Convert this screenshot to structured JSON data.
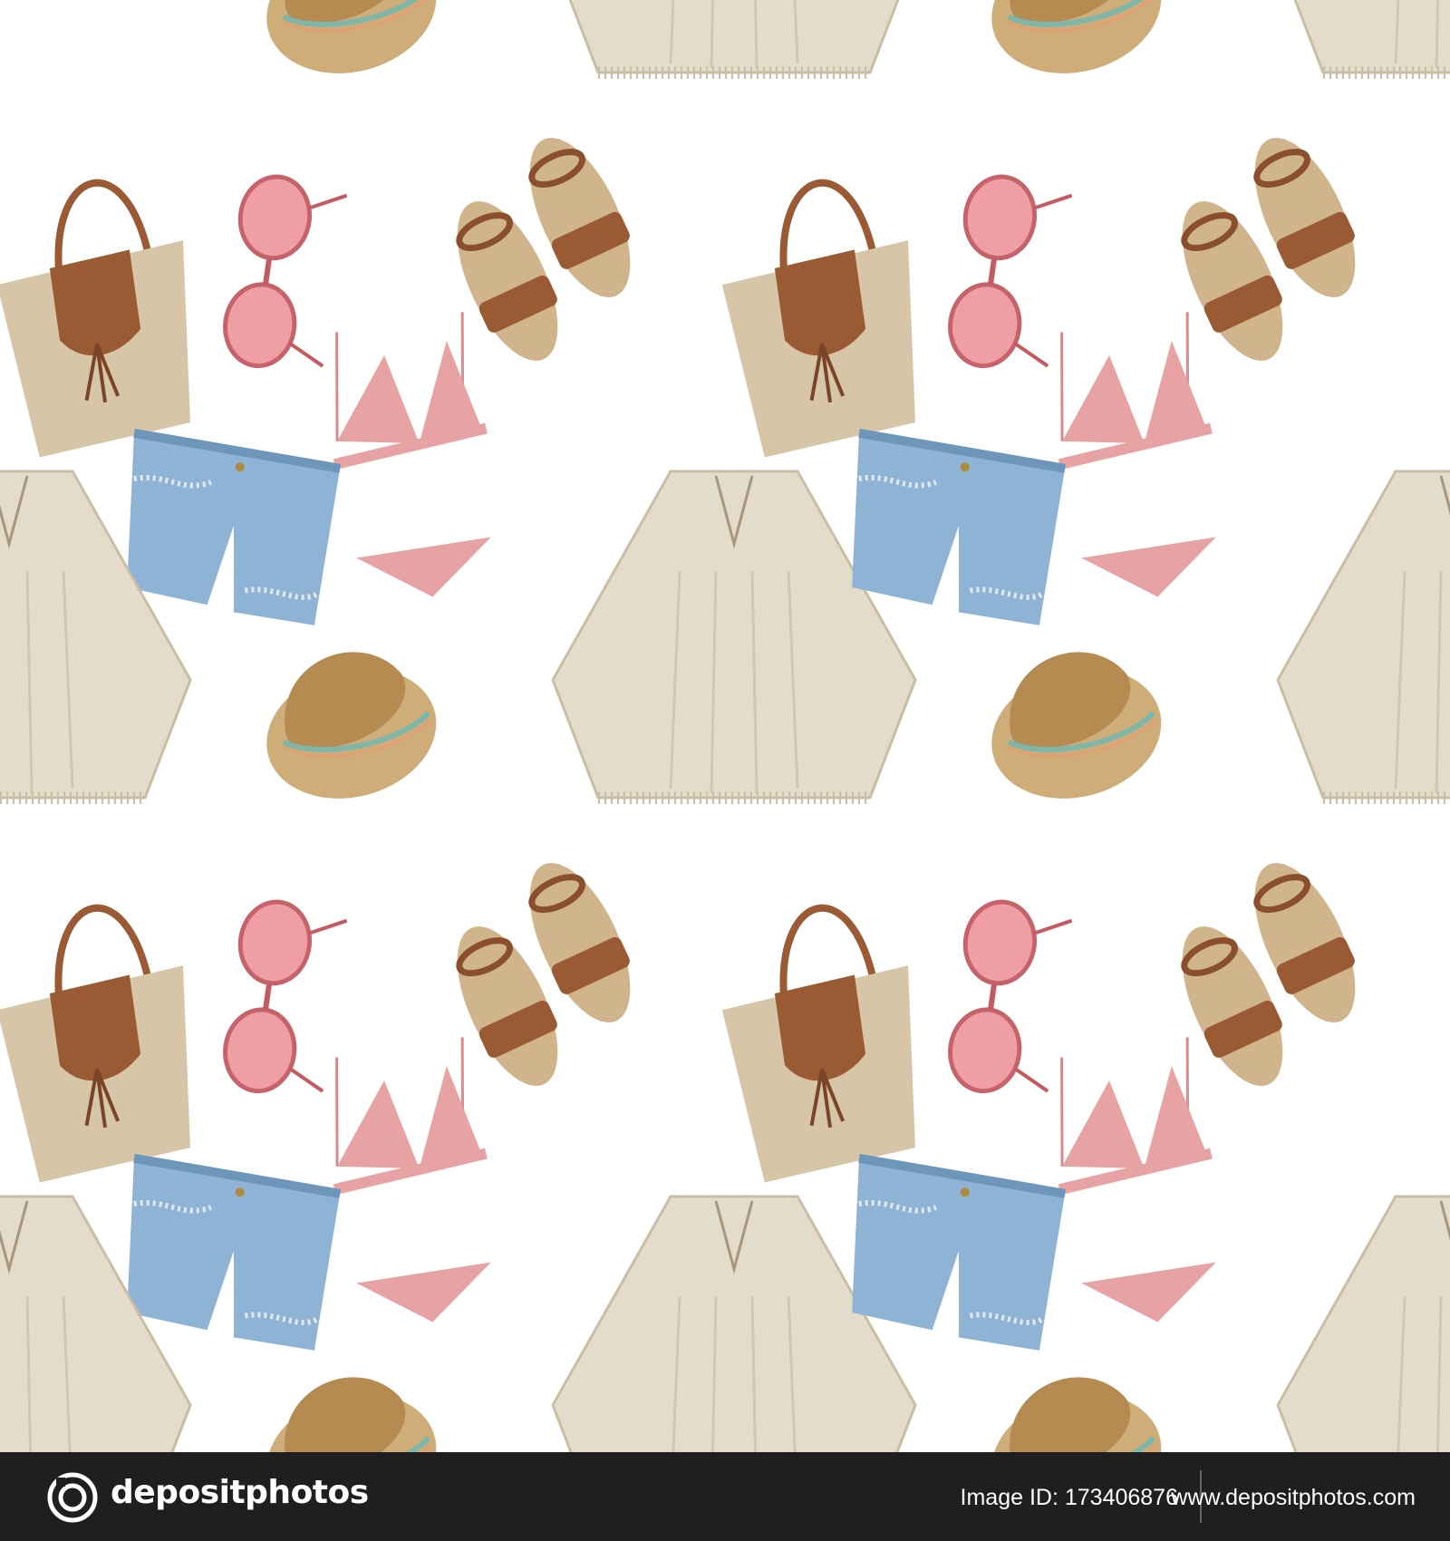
{
  "watermark": {
    "brand": "depositphotos",
    "image_id": "Image ID: 173406876",
    "site": "www.depositphotos.com"
  },
  "pattern": {
    "items": [
      "straw-hat",
      "poncho",
      "straw-bag",
      "sunglasses",
      "sandals",
      "bikini",
      "denim-shorts"
    ]
  },
  "colors": {
    "background": "#ffffff",
    "footer": "#1f1f1f",
    "straw": "#c9a46a",
    "leather": "#9a5a34",
    "linen": "#e4dccb",
    "pink": "#e7a3a3",
    "denim": "#8fb3d4"
  }
}
